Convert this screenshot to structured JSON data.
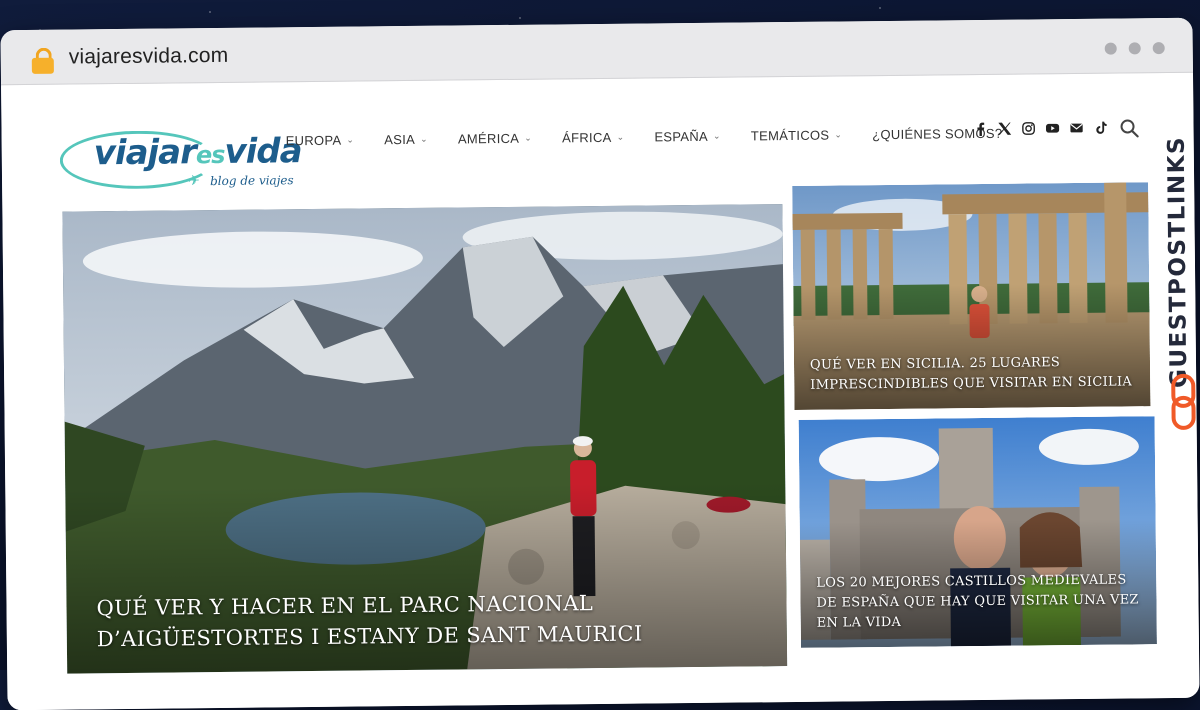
{
  "browser": {
    "url": "viajaresvida.com"
  },
  "logo": {
    "word_a": "viajar",
    "word_b": "es",
    "word_c": "vida",
    "tagline": "blog de viajes"
  },
  "nav": {
    "items": [
      {
        "label": "EUROPA",
        "has_dropdown": true
      },
      {
        "label": "ASIA",
        "has_dropdown": true
      },
      {
        "label": "AMÉRICA",
        "has_dropdown": true
      },
      {
        "label": "ÁFRICA",
        "has_dropdown": true
      },
      {
        "label": "ESPAÑA",
        "has_dropdown": true
      },
      {
        "label": "TEMÁTICOS",
        "has_dropdown": true
      },
      {
        "label": "¿QUIÉNES SOMOS?",
        "has_dropdown": false
      }
    ]
  },
  "social_icons": [
    "facebook-icon",
    "x-icon",
    "instagram-icon",
    "youtube-icon",
    "email-icon",
    "tiktok-icon"
  ],
  "featured": {
    "main": {
      "title": "QUÉ VER Y HACER EN EL PARC NACIONAL D’AIGÜESTORTES I ESTANY DE SANT MAURICI"
    },
    "side": [
      {
        "title": "QUÉ VER EN SICILIA. 25 LUGARES IMPRESCINDIBLES QUE VISITAR EN SICILIA"
      },
      {
        "title": "LOS 20 MEJORES CASTILLOS MEDIEVALES DE ESPAÑA QUE HAY QUE VISITAR UNA VEZ EN LA VIDA"
      }
    ]
  },
  "watermark": {
    "text": "GUESTPOSTLINKS"
  },
  "colors": {
    "brand_blue": "#1d5d8c",
    "brand_teal": "#55c6bb",
    "watermark_orange": "#f05a28"
  }
}
